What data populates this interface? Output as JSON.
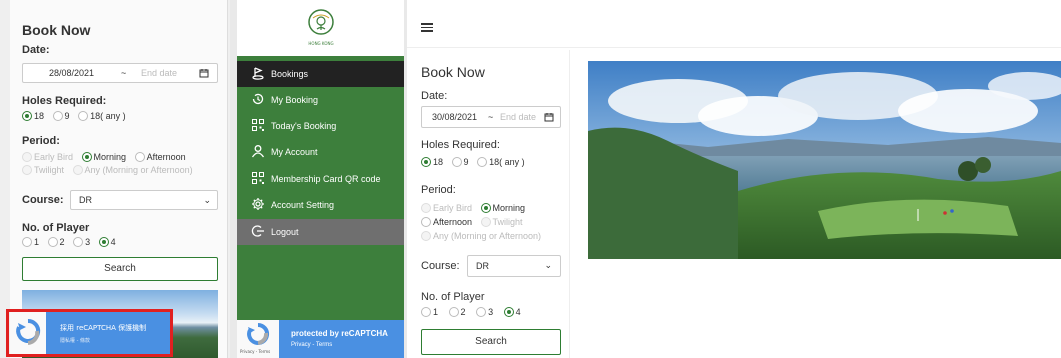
{
  "left_panel": {
    "title": "Book Now",
    "date_label": "Date:",
    "start_date": "28/08/2021",
    "date_separator": "~",
    "end_date_placeholder": "End date",
    "holes_label": "Holes Required:",
    "holes_options": [
      "18",
      "9",
      "18( any )"
    ],
    "holes_selected": "18",
    "period_label": "Period:",
    "period_options": [
      "Early Bird",
      "Morning",
      "Afternoon",
      "Twilight",
      "Any (Morning or Afternoon)"
    ],
    "period_selected": "Morning",
    "course_label": "Course:",
    "course_value": "DR",
    "players_label": "No. of Player",
    "players_options": [
      "1",
      "2",
      "3",
      "4"
    ],
    "players_selected": "4",
    "search_label": "Search",
    "recaptcha_text": "採用 reCAPTCHA 保護機制",
    "recaptcha_links": "隱私權 - 條款"
  },
  "sidebar": {
    "logo_text": "HONG KONG",
    "items": [
      {
        "label": "Bookings",
        "icon": "golf-flag-icon",
        "active": true
      },
      {
        "label": "My Booking",
        "icon": "history-icon",
        "active": false
      },
      {
        "label": "Today's Booking",
        "icon": "qr-code-icon",
        "active": false
      },
      {
        "label": "My Account",
        "icon": "user-icon",
        "active": false
      },
      {
        "label": "Membership Card QR code",
        "icon": "qr-code-icon",
        "active": false
      },
      {
        "label": "Account Setting",
        "icon": "gear-icon",
        "active": false
      },
      {
        "label": "Logout",
        "icon": "logout-icon",
        "active": false
      }
    ],
    "recaptcha_title": "protected by reCAPTCHA",
    "recaptcha_links": "Privacy - Terms",
    "recaptcha_small": "Privacy - Terms"
  },
  "main": {
    "title": "Book Now",
    "date_label": "Date:",
    "start_date": "30/08/2021",
    "date_separator": "~",
    "end_date_placeholder": "End date",
    "holes_label": "Holes Required:",
    "holes_options": [
      "18",
      "9",
      "18( any )"
    ],
    "holes_selected": "18",
    "period_label": "Period:",
    "period_options": [
      "Early Bird",
      "Morning",
      "Afternoon",
      "Twilight",
      "Any (Morning or Afternoon)"
    ],
    "period_selected": "Morning",
    "course_label": "Course:",
    "course_value": "DR",
    "players_label": "No. of Player",
    "players_options": [
      "1",
      "2",
      "3",
      "4"
    ],
    "players_selected": "4",
    "search_label": "Search"
  },
  "colors": {
    "brand_green": "#3d7f3c",
    "active_item": "#222222",
    "logout_item": "#6f6f6f",
    "recaptcha_blue": "#4a90e2",
    "highlight_red": "#e02020"
  }
}
